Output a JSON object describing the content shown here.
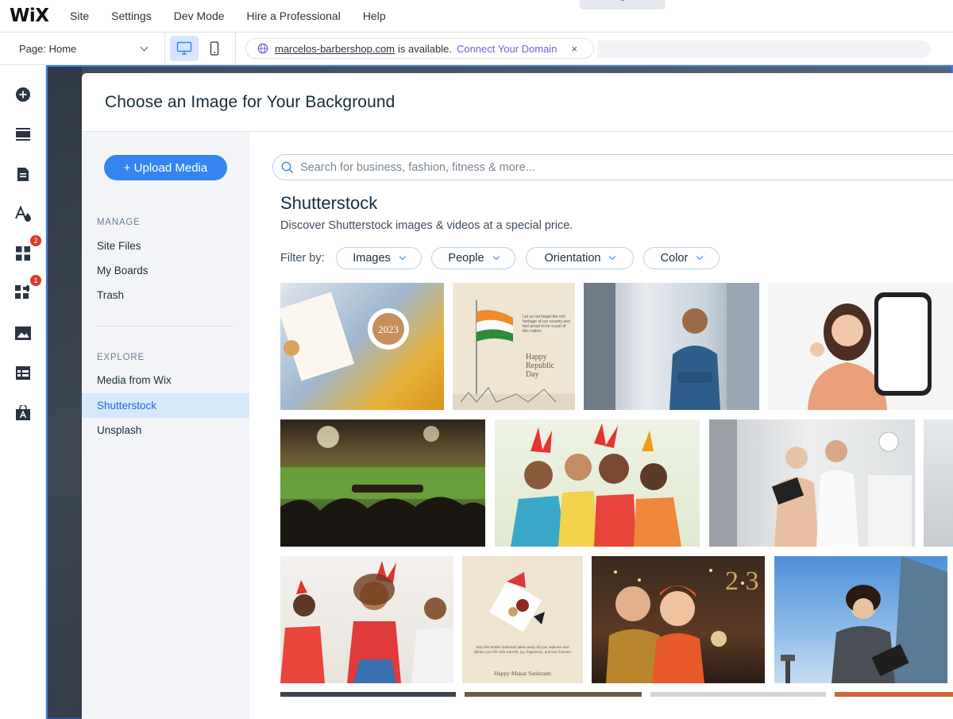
{
  "topbar": {
    "logo": "WiX",
    "menu": [
      "Site",
      "Settings",
      "Dev Mode",
      "Hire a Professional",
      "Help"
    ],
    "collapse_glyph": "⌃"
  },
  "secondbar": {
    "page_label": "Page: Home",
    "domain": {
      "url": "marcelos-barbershop.com",
      "text": "is available.",
      "connect": "Connect Your Domain",
      "close": "×"
    }
  },
  "toolbar_left": {
    "badges": {
      "apps": "2",
      "business": "1"
    }
  },
  "modal": {
    "title": "Choose an Image for Your Background",
    "upload_label": "+ Upload Media",
    "manage_label": "MANAGE",
    "manage_items": [
      "Site Files",
      "My Boards",
      "Trash"
    ],
    "explore_label": "EXPLORE",
    "explore_items": [
      "Media from Wix",
      "Shutterstock",
      "Unsplash"
    ],
    "search_placeholder": "Search for business, fashion, fitness & more...",
    "section_title": "Shutterstock",
    "section_desc": "Discover Shutterstock images & videos at a special price.",
    "filter_label": "Filter by:",
    "filters": [
      "Images",
      "People",
      "Orientation",
      "Color"
    ],
    "thumb_text": {
      "year": "2023",
      "republic": "Happy Republic Day",
      "republic_small": "Let us not forget the rich heritage of our country and feel proud to be a part of this nation.",
      "sankranti": "Happy Makar Sankranti",
      "sankranti_small": "May this Makar Sankranti takes away all your sadness and lighten your life with warmth, joy, happiness, and love forever!"
    }
  },
  "colors": {
    "accent": "#3584f0",
    "active_nav_bg": "#d6e8fb",
    "badge": "#e0352b",
    "connect_link": "#7a5bd5"
  }
}
